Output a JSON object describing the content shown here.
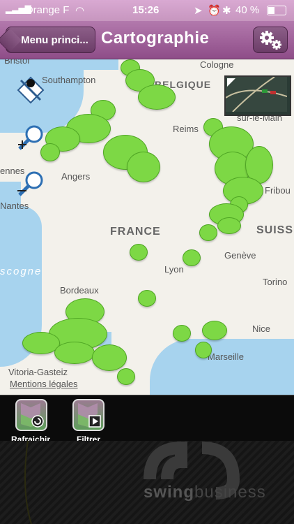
{
  "status": {
    "carrier": "Orange F",
    "time": "15:26",
    "battery": "40 %"
  },
  "nav": {
    "back_label": "Menu princi...",
    "title": "Cartographie"
  },
  "map": {
    "places": [
      "Southampton",
      "Cologne",
      "BELGIQUE",
      "Bristol",
      "Reims",
      "sur-le-Main",
      "ennes",
      "Angers",
      "Fribou",
      "Nantes",
      "FRANCE",
      "SUISSE",
      "Genève",
      "Lyon",
      "scogne",
      "Bordeaux",
      "Torino",
      "Nice",
      "Marseille",
      "Vitoria-Gasteiz"
    ],
    "legal": "Mentions légales"
  },
  "toolbar": {
    "refresh_label": "Rafraichir",
    "filter_label": "Filtrer"
  },
  "brand": {
    "word1": "swing",
    "word2": "business"
  }
}
